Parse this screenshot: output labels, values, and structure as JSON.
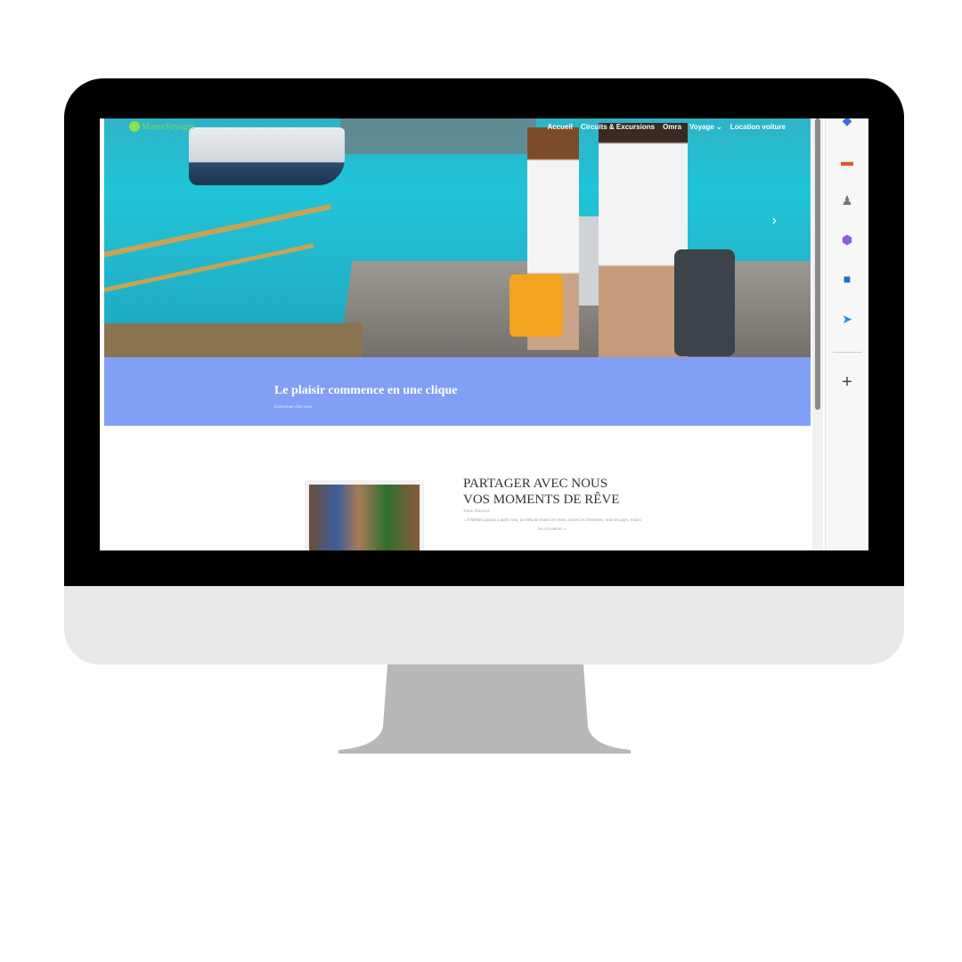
{
  "site": {
    "logo": "MarenVoyages",
    "nav": [
      "Accueil",
      "Circuits & Excursions",
      "Omra",
      "Voyage ⌄",
      "Location voiture"
    ],
    "next_arrow": "›"
  },
  "banner": {
    "title": "Le plaisir commence en une clique",
    "subtitle": "Bienvenue chez nous"
  },
  "section": {
    "title_line1": "PARTAGER AVEC NOUS",
    "title_line2": "VOS MOMENTS DE RÊVE",
    "author": "Amin Maalouf.",
    "quote": "« N'hésitez jamais à partir loin, au-delà de toutes les mers, toutes les frontières, tous les pays, toutes les croyances. »"
  },
  "sidebar": {
    "icons": [
      "tag-icon",
      "toolbox-icon",
      "games-icon",
      "copilot-icon",
      "outlook-icon",
      "telegram-icon"
    ],
    "add": "+"
  }
}
